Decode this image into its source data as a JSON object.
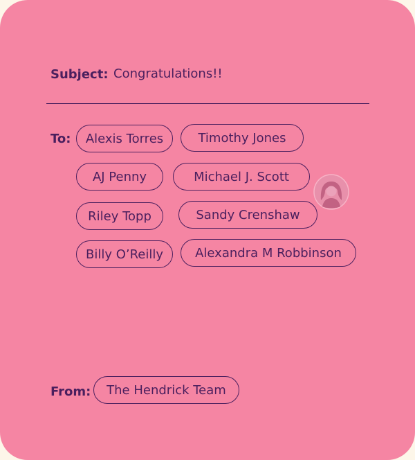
{
  "subject": {
    "label": "Subject:",
    "value": "Congratulations!!"
  },
  "to": {
    "label": "To:",
    "recipients": [
      "Alexis Torres",
      "Timothy Jones",
      "AJ Penny",
      "Michael J. Scott",
      "Riley Topp",
      "Sandy Crenshaw",
      "Billy O’Reilly",
      "Alexandra M Robbinson"
    ]
  },
  "from": {
    "label": "From:",
    "sender": "The Hendrick Team"
  },
  "colors": {
    "background": "#f585a3",
    "ink": "#4a1f5e",
    "page": "#fdf6e9"
  },
  "icons": {
    "dragging_avatar": "user-avatar-icon"
  }
}
